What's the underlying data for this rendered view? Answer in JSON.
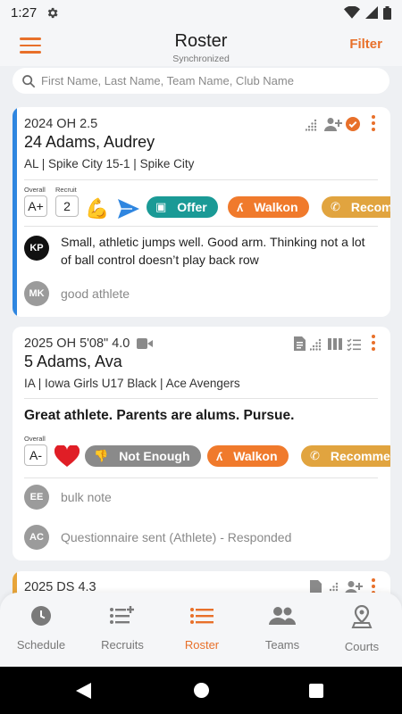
{
  "status": {
    "time": "1:27"
  },
  "header": {
    "title": "Roster",
    "subtitle": "Synchronized",
    "filter": "Filter"
  },
  "search": {
    "placeholder": "First Name, Last Name, Team Name, Club Name",
    "value": ""
  },
  "cards": [
    {
      "accent": "#2f86e0",
      "line1": "2024 OH 2.5",
      "name": "24 Adams, Audrey",
      "line3": "AL  | Spike City 15-1 | Spike City",
      "grades": {
        "overall_label": "Overall",
        "overall": "A+",
        "recruit_label": "Recruit",
        "recruit": "2"
      },
      "pills": {
        "offer": "Offer",
        "walkon": "Walkon",
        "recommend": "Recom"
      },
      "notes": [
        {
          "initials": "KP",
          "text": "Small, athletic jumps well. Good arm. Thinking not a lot of ball control doesn’t play back row"
        },
        {
          "initials": "MK",
          "text": "good athlete"
        }
      ]
    },
    {
      "line1": "2025 OH 5'08\" 4.0",
      "name": "5 Adams, Ava",
      "line3": "IA  | Iowa Girls U17 Black | Ace Avengers",
      "highlight": "Great athlete. Parents are alums. Pursue.",
      "grades": {
        "overall_label": "Overall",
        "overall": "A-"
      },
      "pills": {
        "not_enough": "Not Enough",
        "walkon": "Walkon",
        "recommend": "Recomme"
      },
      "notes": [
        {
          "initials": "EE",
          "text": "bulk note"
        },
        {
          "initials": "AC",
          "text": "Questionnaire sent (Athlete) - Responded"
        }
      ]
    },
    {
      "accent": "#e8a53a",
      "line1": "2025 DS 4.3"
    }
  ],
  "nav": [
    {
      "label": "Schedule",
      "icon": "clock-icon"
    },
    {
      "label": "Recruits",
      "icon": "list-add-icon"
    },
    {
      "label": "Roster",
      "icon": "list-icon",
      "active": true
    },
    {
      "label": "Teams",
      "icon": "people-icon"
    },
    {
      "label": "Courts",
      "icon": "map-pin-icon"
    }
  ],
  "colors": {
    "brand": "#e8702a",
    "offer": "#1a9a96",
    "walkon": "#f07a2c",
    "recommend": "#e1a43f",
    "not_enough": "#8a8a8a"
  }
}
